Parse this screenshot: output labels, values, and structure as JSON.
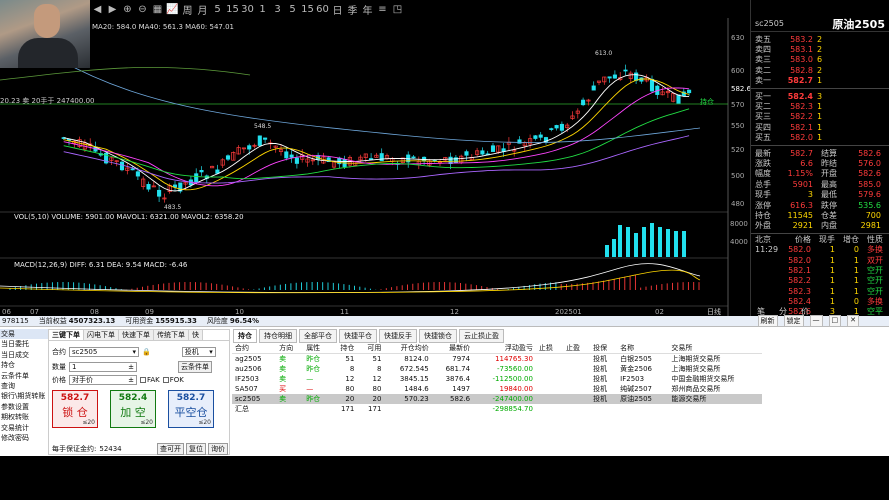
{
  "toolbar": {
    "buttons": [
      "◀",
      "▶",
      "⊕",
      "⊖",
      "▦",
      "📈",
      "周",
      "月",
      "5",
      "15",
      "30",
      "1",
      "3",
      "5",
      "15",
      "60",
      "日",
      "季",
      "年",
      "≡",
      "◳"
    ]
  },
  "chart": {
    "ma_legend": "MA20: 584.0 MA40: 561.3 MA60: 547.01",
    "price_label_fullview": "20.23 卖 20手于 247400.00",
    "price_axis": [
      "630",
      "600",
      "582.6",
      "570",
      "550",
      "520",
      "500",
      "480"
    ],
    "high_label": "613.0",
    "mid_label": "548.5",
    "low_label": "483.5",
    "hold_label": "持仓",
    "vol_legend": "VOL(5,10) VOLUME: 5901.00 MAVOL1: 6321.00 MAVOL2: 6358.20",
    "vol_axis": [
      "8000",
      "4000"
    ],
    "macd_legend": "MACD(12,26,9) DIFF: 6.31 DEA: 9.54 MACD: -6.46",
    "x_axis": [
      "06",
      "07",
      "08",
      "09",
      "10",
      "11",
      "12",
      "202501",
      "02"
    ],
    "bottom_tabs": [
      "日线"
    ]
  },
  "quote": {
    "code": "sc2505",
    "name": "原油2505",
    "sells": [
      {
        "label": "卖五",
        "price": "583.2",
        "vol": "2"
      },
      {
        "label": "卖四",
        "price": "583.1",
        "vol": "2"
      },
      {
        "label": "卖三",
        "price": "583.0",
        "vol": "6"
      },
      {
        "label": "卖二",
        "price": "582.8",
        "vol": "2"
      },
      {
        "label": "卖一",
        "price": "582.7",
        "vol": "1"
      }
    ],
    "buys": [
      {
        "label": "买一",
        "price": "582.4",
        "vol": "3"
      },
      {
        "label": "买二",
        "price": "582.3",
        "vol": "1"
      },
      {
        "label": "买三",
        "price": "582.2",
        "vol": "1"
      },
      {
        "label": "买四",
        "price": "582.1",
        "vol": "1"
      },
      {
        "label": "买五",
        "price": "582.0",
        "vol": "1"
      }
    ],
    "stats": [
      {
        "k1": "最新",
        "v1": "582.7",
        "k2": "结算",
        "v2": "582.6"
      },
      {
        "k1": "涨跌",
        "v1": "6.6",
        "k2": "昨结",
        "v2": "576.0"
      },
      {
        "k1": "幅度",
        "v1": "1.15%",
        "k2": "开盘",
        "v2": "582.6"
      },
      {
        "k1": "总手",
        "v1": "5901",
        "k2": "最高",
        "v2": "585.0"
      },
      {
        "k1": "现手",
        "v1": "3",
        "k2": "最低",
        "v2": "579.6"
      },
      {
        "k1": "涨停",
        "v1": "616.3",
        "k2": "跌停",
        "v2": "535.6"
      },
      {
        "k1": "持仓",
        "v1": "11545",
        "k2": "仓差",
        "v2": "700"
      },
      {
        "k1": "外盘",
        "v1": "2921",
        "k2": "内盘",
        "v2": "2981"
      }
    ],
    "ticks_header": [
      "北京",
      "价格",
      "现手",
      "增仓",
      "性质"
    ],
    "ticks": [
      {
        "t": "11:29",
        "p": "582.0",
        "v": "1",
        "d": "0",
        "n": "多换"
      },
      {
        "t": "",
        "p": "582.0",
        "v": "1",
        "d": "1",
        "n": "双开"
      },
      {
        "t": "",
        "p": "582.1",
        "v": "1",
        "d": "1",
        "n": "空开"
      },
      {
        "t": "",
        "p": "582.2",
        "v": "1",
        "d": "1",
        "n": "空开"
      },
      {
        "t": "",
        "p": "582.3",
        "v": "1",
        "d": "1",
        "n": "空开"
      },
      {
        "t": "",
        "p": "582.4",
        "v": "1",
        "d": "0",
        "n": "多换"
      },
      {
        "t": "",
        "p": "582.6",
        "v": "3",
        "d": "1",
        "n": "空平"
      }
    ],
    "bottom_labels": [
      "笔",
      "分",
      "价"
    ]
  },
  "account": {
    "id": "978115",
    "equity_label": "当前权益",
    "equity": "4507323.13",
    "available_label": "可用资金",
    "available": "155915.33",
    "risk_label": "风险度",
    "risk": "96.54%"
  },
  "side_menu": [
    "交易",
    "当日委托",
    "当日成交",
    "持仓",
    "云条件单",
    "查询",
    "银行\\期货转账",
    "参数设置",
    "期权转账",
    "交易统计",
    "修改密码"
  ],
  "order": {
    "tabs": [
      "三键下单",
      "闪电下单",
      "快速下单",
      "传统下单",
      "快"
    ],
    "contract_label": "合约",
    "contract": "sc2505",
    "type": "投机",
    "qty_label": "数量",
    "qty": "1",
    "price_label": "价格",
    "price": "对手价",
    "fak": "FAK",
    "fok": "FOK",
    "cloud_btn": "云条件单",
    "buttons": [
      {
        "price": "582.7",
        "label": "锁 仓",
        "sub": "≤20"
      },
      {
        "price": "582.4",
        "label": "加 空",
        "sub": "≤20"
      },
      {
        "price": "582.7",
        "label": "平空仓",
        "sub": "≤20"
      }
    ],
    "margin_label": "每手保证金约:",
    "margin": "52434",
    "actions": [
      "查可开",
      "复位",
      "询价"
    ]
  },
  "positions": {
    "tabs": [
      "持仓",
      "持仓明细",
      "全部平仓",
      "快捷平仓",
      "快捷反手",
      "快捷锁仓",
      "云止损止盈"
    ],
    "headers": [
      "合约",
      "方向",
      "属性",
      "持仓",
      "可用",
      "开仓均价",
      "最新价",
      "浮动盈亏",
      "止损",
      "止盈",
      "投保",
      "名称",
      "交易所"
    ],
    "rows": [
      {
        "c": "ag2505",
        "dir": "卖",
        "attr": "昨仓",
        "hold": "51",
        "avail": "51",
        "open": "8124.0",
        "last": "7974",
        "pnl": "114765.30",
        "hedge": "投机",
        "name": "白银2505",
        "ex": "上海期货交易所",
        "type": "sell"
      },
      {
        "c": "au2506",
        "dir": "卖",
        "attr": "昨仓",
        "hold": "8",
        "avail": "8",
        "open": "672.545",
        "last": "681.74",
        "pnl": "-73560.00",
        "hedge": "投机",
        "name": "黄金2506",
        "ex": "上海期货交易所",
        "type": "sell"
      },
      {
        "c": "IF2503",
        "dir": "卖",
        "attr": "—",
        "hold": "12",
        "avail": "12",
        "open": "3845.15",
        "last": "3876.4",
        "pnl": "-112500.00",
        "hedge": "投机",
        "name": "IF2503",
        "ex": "中国金融期货交易所",
        "type": "sell"
      },
      {
        "c": "SA507",
        "dir": "买",
        "attr": "—",
        "hold": "80",
        "avail": "80",
        "open": "1484.6",
        "last": "1497",
        "pnl": "19840.00",
        "hedge": "投机",
        "name": "纯碱2507",
        "ex": "郑州商品交易所",
        "type": "buy"
      },
      {
        "c": "sc2505",
        "dir": "卖",
        "attr": "昨仓",
        "hold": "20",
        "avail": "20",
        "open": "570.23",
        "last": "582.6",
        "pnl": "-247400.00",
        "hedge": "投机",
        "name": "原油2505",
        "ex": "能源交易所",
        "type": "selected"
      }
    ],
    "total_label": "汇总",
    "total_hold": "171",
    "total_avail": "171",
    "total_pnl": "-298854.70"
  },
  "window_buttons": [
    "刷新",
    "锁定",
    "—",
    "□",
    "✕"
  ]
}
